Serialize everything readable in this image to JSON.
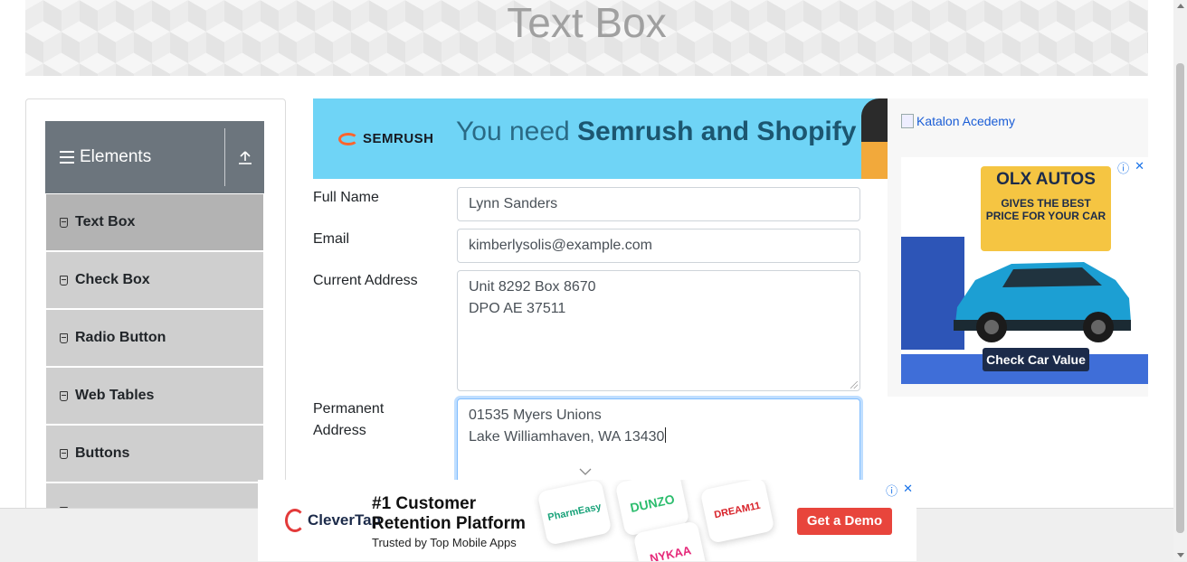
{
  "page": {
    "title": "Text Box"
  },
  "sidebar": {
    "group_title": "Elements",
    "items": [
      {
        "label": "Text Box",
        "active": true
      },
      {
        "label": "Check Box"
      },
      {
        "label": "Radio Button"
      },
      {
        "label": "Web Tables"
      },
      {
        "label": "Buttons"
      }
    ]
  },
  "semrush_ad": {
    "brand": "SEMRUSH",
    "text_prefix": "You need ",
    "text_bold": "Semrush and Shopify"
  },
  "form": {
    "full_name": {
      "label": "Full Name",
      "value": "Lynn Sanders"
    },
    "email": {
      "label": "Email",
      "value": "kimberlysolis@example.com"
    },
    "current_address": {
      "label": "Current Address",
      "lines": [
        "Unit 8292 Box 8670",
        "DPO AE 37511"
      ]
    },
    "permanent_address": {
      "label_line1": "Permanent",
      "label_line2": "Address",
      "lines": [
        "01535 Myers Unions",
        "Lake Williamhaven, WA 13430"
      ]
    }
  },
  "right_ads": {
    "katalon_alt": "Katalon Acedemy",
    "olx": {
      "title": "OLX AUTOS",
      "subtitle": "GIVES THE BEST PRICE FOR YOUR CAR",
      "cta": "Check Car Value"
    }
  },
  "bottom_ad": {
    "brand": "CleverTap",
    "headline_line1": "#1 Customer",
    "headline_line2": "Retention Platform",
    "trust": "Trusted by Top Mobile Apps",
    "tiles": [
      "PharmEasy",
      "DUNZO",
      "DREAM11",
      "NYKAA"
    ],
    "cta": "Get a Demo"
  },
  "colors": {
    "sidebar_header": "#6c757d",
    "menu_item": "#cfcfcf",
    "menu_item_active": "#b3b3b3",
    "semrush_bg": "#6fd4f6",
    "olx_badge": "#f5c542",
    "clevertap_cta": "#e8453c"
  }
}
